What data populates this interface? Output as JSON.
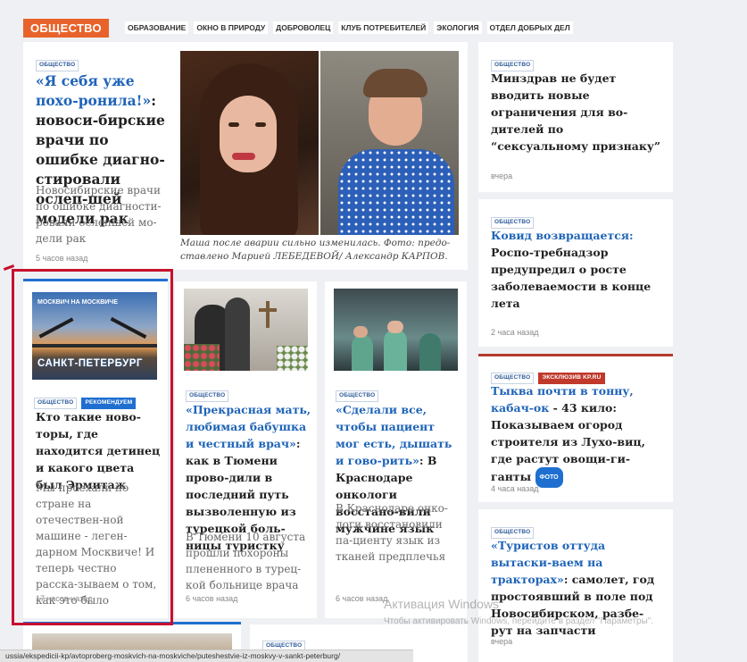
{
  "header": {
    "section_label": "ОБЩЕСТВО",
    "rubrics": [
      "ОБРАЗОВАНИЕ",
      "ОКНО В ПРИРОДУ",
      "ДОБРОВОЛЕЦ",
      "КЛУБ ПОТРЕБИТЕЛЕЙ",
      "ЭКОЛОГИЯ",
      "ОТДЕЛ ДОБРЫХ ДЕЛ"
    ]
  },
  "main_story": {
    "tag": "ОБЩЕСТВО",
    "title_link": "«Я себя уже похо-ронила!»",
    "title_rest": ": новоси-бирские врачи по ошибке диагно-стировали ослеп-шей модели рак",
    "lead": "Новосибирские врачи по ошибке диагности-ровали ослепшей мо-дели рак",
    "time": "5 часов назад",
    "caption": "Маша после аварии сильно изменилась. Фото: предо-ставлено Марией ЛЕБЕДЕВОЙ/ Александр КАРПОВ."
  },
  "right_col": [
    {
      "tag": "ОБЩЕСТВО",
      "title": "Минздрав не будет вводить новые ограничения для во-дителей по “сексуальному признаку”",
      "time": "вчера"
    },
    {
      "tag": "ОБЩЕСТВО",
      "title_link": "Ковид возвращается:",
      "title_rest": " Роспо-требнадзор предупредил о росте заболеваемости в конце лета",
      "time": "2 часа назад"
    },
    {
      "tag": "ОБЩЕСТВО",
      "tag2": "ЭКСКЛЮЗИВ KP.RU",
      "title_link": "Тыква почти в тонну, кабач-ок",
      "title_rest": " - 43 кило: Показываем огород строителя из Лухо-виц, где растут овощи-ги-ганты",
      "badge": "ФОТО",
      "time": "4 часа назад"
    },
    {
      "tag": "ОБЩЕСТВО",
      "title_link": "«Туристов оттуда вытаски-ваем на тракторах»",
      "title_rest": ": самолет, год простоявший в поле под Новосибирском, разбе-рут на запчасти",
      "time": "вчера"
    }
  ],
  "row2": [
    {
      "tag": "ОБЩЕСТВО",
      "tag2": "РЕКОМЕНДУЕМ",
      "image_text_top": "МОСКВИЧ НА МОСКВИЧЕ",
      "image_text": "САНКТ-ПЕТЕРБУРГ",
      "title": "Кто такие ново-торы, где находится детинец и какого цвета был Эрмитаж",
      "lead": "Мы проехали по стране на отечествен-ной машине - леген-дарном Москвиче! И теперь честно расска-зываем о том, как это было",
      "time": "17 часов назад"
    },
    {
      "tag": "ОБЩЕСТВО",
      "title_link": "«Прекрасная мать, любимая бабушка и честный врач»",
      "title_rest": ": как в Тюмени прово-дили в последний путь вызволенную из турецкой боль-ницы туристку",
      "lead": "В Тюмени 10 августа прошли похороны плененного в турец-кой больнице врача",
      "time": "6 часов назад"
    },
    {
      "tag": "ОБЩЕСТВО",
      "title_link": "«Сделали все, чтобы пациент мог есть, дышать и гово-рить»",
      "title_rest": ": В Краснодаре онкологи восстано-вили мужчине язык",
      "lead": "В Краснодаре онко-логи восстановили па-циенту язык из тканей предплечья",
      "time": "6 часов назад"
    }
  ],
  "row3": {
    "tag": "ОБЩЕСТВО"
  },
  "watermark": {
    "line1": "Активация Windows",
    "line2": "Чтобы активировать Windows, перейдите в раздел \"Параметры\"."
  },
  "status_url": "ussia/ekspedicii-kp/avtoproberg-moskvich-na-moskviche/puteshestvie-iz-moskvy-v-sankt-peterburg/"
}
